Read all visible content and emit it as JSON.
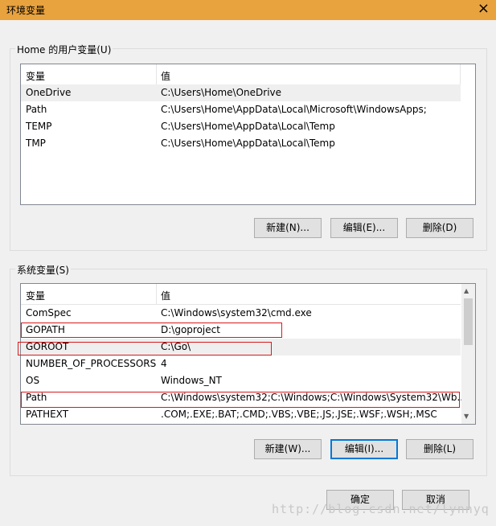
{
  "window": {
    "title": "环境变量",
    "close_icon": "×"
  },
  "user_group": {
    "label": "Home 的用户变量(U)",
    "col_var": "变量",
    "col_val": "值",
    "rows": [
      {
        "name": "OneDrive",
        "value": "C:\\Users\\Home\\OneDrive"
      },
      {
        "name": "Path",
        "value": "C:\\Users\\Home\\AppData\\Local\\Microsoft\\WindowsApps;"
      },
      {
        "name": "TEMP",
        "value": "C:\\Users\\Home\\AppData\\Local\\Temp"
      },
      {
        "name": "TMP",
        "value": "C:\\Users\\Home\\AppData\\Local\\Temp"
      }
    ],
    "buttons": {
      "new": "新建(N)...",
      "edit": "编辑(E)...",
      "delete": "删除(D)"
    }
  },
  "system_group": {
    "label": "系统变量(S)",
    "col_var": "变量",
    "col_val": "值",
    "rows": [
      {
        "name": "ComSpec",
        "value": "C:\\Windows\\system32\\cmd.exe"
      },
      {
        "name": "GOPATH",
        "value": "D:\\goproject"
      },
      {
        "name": "GOROOT",
        "value": "C:\\Go\\"
      },
      {
        "name": "NUMBER_OF_PROCESSORS",
        "value": "4"
      },
      {
        "name": "OS",
        "value": "Windows_NT"
      },
      {
        "name": "Path",
        "value": "C:\\Windows\\system32;C:\\Windows;C:\\Windows\\System32\\Wb..."
      },
      {
        "name": "PATHEXT",
        "value": ".COM;.EXE;.BAT;.CMD;.VBS;.VBE;.JS;.JSE;.WSF;.WSH;.MSC"
      }
    ],
    "buttons": {
      "new": "新建(W)...",
      "edit": "编辑(I)...",
      "delete": "删除(L)"
    }
  },
  "footer": {
    "ok": "确定",
    "cancel": "取消"
  },
  "watermark": "http://blog.csdn.net/lynnyq",
  "colors": {
    "titlebar": "#e8a23e",
    "highlight_box": "#d9191b",
    "focus_border": "#0078d7"
  }
}
